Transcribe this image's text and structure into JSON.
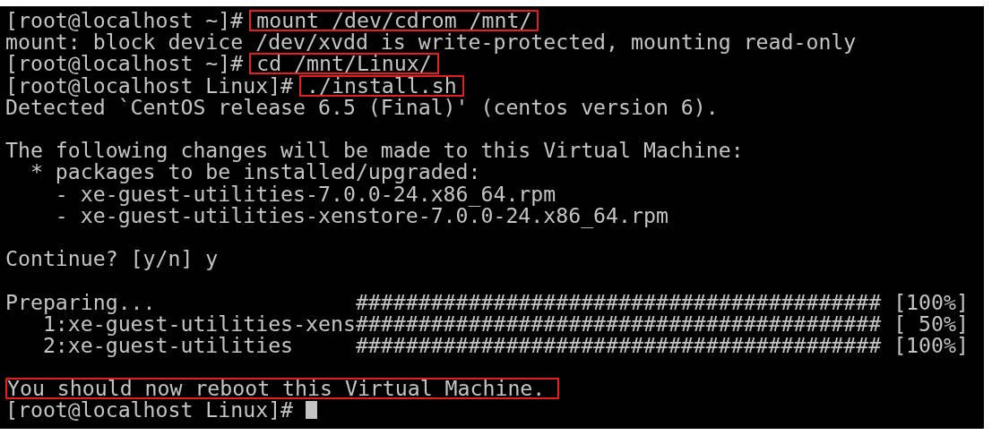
{
  "terminal": {
    "lines": [
      {
        "kind": "command",
        "prompt": "[root@localhost ~]#",
        "text": "mount /dev/cdrom /mnt/",
        "highlighted": true
      },
      {
        "kind": "output",
        "text": "mount: block device /dev/xvdd is write-protected, mounting read-only",
        "highlighted": false
      },
      {
        "kind": "command",
        "prompt": "[root@localhost ~]#",
        "text": "cd /mnt/Linux/",
        "highlighted": true
      },
      {
        "kind": "command",
        "prompt": "[root@localhost Linux]#",
        "text": "./install.sh",
        "highlighted": true
      },
      {
        "kind": "output",
        "text": "Detected `CentOS release 6.5 (Final)' (centos version 6).",
        "highlighted": false
      },
      {
        "kind": "blank"
      },
      {
        "kind": "output",
        "text": "The following changes will be made to this Virtual Machine:",
        "highlighted": false
      },
      {
        "kind": "output",
        "text": "  * packages to be installed/upgraded:",
        "highlighted": false
      },
      {
        "kind": "output",
        "text": "    - xe-guest-utilities-7.0.0-24.x86_64.rpm",
        "highlighted": false
      },
      {
        "kind": "output",
        "text": "    - xe-guest-utilities-xenstore-7.0.0-24.x86_64.rpm",
        "highlighted": false
      },
      {
        "kind": "blank"
      },
      {
        "kind": "output",
        "text": "Continue? [y/n] y",
        "highlighted": false
      },
      {
        "kind": "blank"
      },
      {
        "kind": "progress",
        "name": "Preparing...",
        "hashes": "##########################################",
        "percent": "[100%]"
      },
      {
        "kind": "progress",
        "name": "   1:xe-guest-utilities-xens",
        "hashes": "##########################################",
        "percent": "[ 50%]"
      },
      {
        "kind": "progress",
        "name": "   2:xe-guest-utilities",
        "hashes": "##########################################",
        "percent": "[100%]"
      },
      {
        "kind": "blank"
      },
      {
        "kind": "output",
        "text": "You should now reboot this Virtual Machine.",
        "highlighted": true
      },
      {
        "kind": "command",
        "prompt": "[root@localhost Linux]#",
        "cursor": true
      }
    ]
  }
}
